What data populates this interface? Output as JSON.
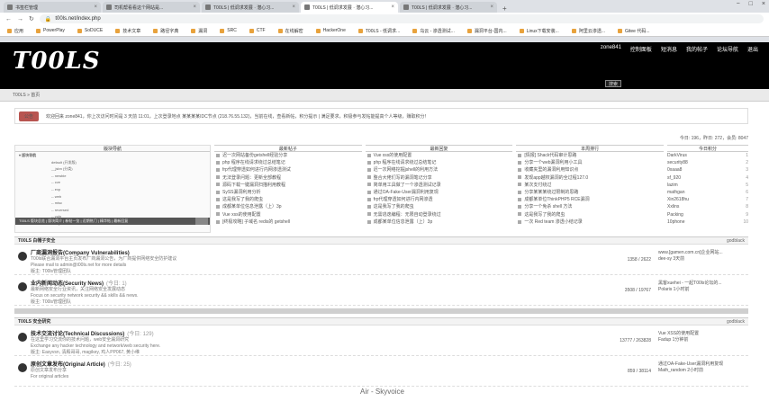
{
  "browser": {
    "tabs": [
      {
        "title": "书签栏管理",
        "active": false
      },
      {
        "title": "司机帮看看这个网站是...",
        "active": false
      },
      {
        "title": "T00LS | 低调求发展 · 潜心习...",
        "active": false
      },
      {
        "title": "T00LS | 低调求发展 · 潜心习...",
        "active": true
      },
      {
        "title": "T00LS | 低调求发展 · 潜心习...",
        "active": false
      }
    ],
    "new_tab": "+",
    "window_controls": [
      "−",
      "□",
      "×"
    ],
    "back": "←",
    "forward": "→",
    "reload": "↻",
    "url": "t00ls.net/index.php",
    "bookmarks": [
      "应用",
      "PowerPlay",
      "SoDUCE",
      "技术文章",
      "路径字典",
      "漏洞",
      "SRC",
      "CTF",
      "在线解密",
      "HackerOne",
      "T00LS - 低调求...",
      "乌云 - 渗透测试...",
      "漏洞平台-国内...",
      "Linux下载安装...",
      "阿里云渗透...",
      "Gitee 代码..."
    ]
  },
  "header": {
    "logo": "T00LS",
    "user_nav": [
      "zone841",
      "控制面板",
      "短消息",
      "我的帖子",
      "论坛导航",
      "退出"
    ],
    "header_button": "搜索"
  },
  "breadcrumb": "T00LS » 首页",
  "notice": {
    "button": "公告",
    "text": "欢迎回来 zone841，你上次访问时间是 3 天前 11:01，上次登录地点 某某某某IDC节点 (218.76.55.132)，当前在线，查看新帖，积分提示 | 满足要求，积极参与发帖能提高个人等级，赚取积分！"
  },
  "stats": "今日: 196，昨日: 272，会员: 8047",
  "columns": {
    "tree": "版块导航",
    "new": "最新帖子",
    "hot": "最新回复",
    "week": "本周排行",
    "rank": "今日积分"
  },
  "tree_items": [
    "▾ 版块导航",
    "default (开发版)",
    "__jsbn (分类)",
    "-- newbie",
    "-- cve",
    "-- exp",
    "-- web",
    "-- misc",
    "-- reversed",
    "-- vuln",
    "-- exploit"
  ],
  "tree_bar": "T00LS 版块总览 | 版块简介 | 新帖一览 | 近期热门 | 精华帖 | 最新回复",
  "new_posts": [
    "迟一次网站备份getshell经验分享",
    "php 程序在线请求绕过总结笔记",
    "frp代理穿透如何进行内网渗透测试",
    "无法登录问题：更新全部教程",
    "源码下载一键漏洞扫描利用教程",
    "SySS漏洞利用分析",
    "这是我写了我的爬虫",
    "成都某单位信息泄露（上）3p",
    "Vue xss的使用配置",
    "[终极攻略] 子域名 redis的 getshell"
  ],
  "replies": [
    "Vue xss的使用配置",
    "php 程序在线请求绕过总结笔记",
    "迟一次网络挖掘jshell的利用方法",
    "整合大佬们写的漏洞笔记分享",
    "简单用工具做了一个渗透测试记录",
    "通过OA-Fake-User漏洞利用复现",
    "frp代理穿透如何进行内网渗透",
    "这是我写了我的爬虫",
    "无需逃逸编程：无限自动登录绕过",
    "成都某单位信息泄露（上）3p"
  ],
  "week": [
    "[情报] Shack代码审计思路",
    "分享一个web漏洞利用小工具",
    "收藏夹里的漏洞利用知识点",
    "发现app越权漏洞的全过程127.0",
    "某次支付绕过",
    "分享某某某绕过限制的思路",
    "成都某单位ThinkPHP5 RCE漏洞",
    "分享一个免杀 shell 方法",
    "这是我写了我的爬虫",
    "一次 Red team 渗透小结记录"
  ],
  "ranks": [
    [
      "DarkVirus",
      "1"
    ],
    [
      "security88",
      "2"
    ],
    [
      "0xaaa8",
      "3"
    ],
    [
      "sf_920",
      "4"
    ],
    [
      "lazim",
      "5"
    ],
    [
      "mathgan",
      "6"
    ],
    [
      "Xin2618hu",
      "7"
    ],
    [
      "Xxlins",
      "8"
    ],
    [
      "Packing",
      "9"
    ],
    [
      "10phone",
      "10"
    ]
  ],
  "sections": [
    {
      "name": "T00LS 白帽子安全",
      "moderator": "godblack",
      "forums": [
        {
          "title": "厂商漏洞报告(Company Vulnerabilities)",
          "desc1": "T00ls联合漏洞平台主页发布厂商漏洞公告，为厂商提供网络安全防护建议",
          "desc2": "Please mail to admin@t00ls.net for more details",
          "desc3": "版主: T00ls管理团队",
          "count": "1358 / 2622",
          "last1": "www.[gamen.com.cn]企业网站...",
          "last2": "dee-sy  3天前"
        },
        {
          "title": "业内新闻动态(Security News)",
          "today": "(今日: 1)",
          "desc1": "最新网络安全行业资讯，关注网络安全发展动态",
          "desc2": "Focus on security network security && skills && news.",
          "desc3": "版主: T00ls管理团队",
          "count": "3508 / 19767",
          "last1": "黑客xuehei - 一起T00ls论坛的...",
          "last2": "Polaris  1小时前"
        }
      ]
    },
    {
      "name": "T00LS 安全研究",
      "moderator": "godblack",
      "forums": [
        {
          "title": "技术交流讨论(Technical Discussions)",
          "today": "(今日: 129)",
          "desc1": "在这里学习交流你的技术问题，web安全漏洞研究",
          "desc2": "Exchange any hacker technology and network/web security here.",
          "desc3": "版主: Easyvsn, 清殿哥哥, magikey, 鸡人PP067, 黄小维",
          "count": "13777 / 263828",
          "last1": "Vue XSS的使用配置",
          "last2": "Fadup  1分钟前"
        },
        {
          "title": "原创文章发布(Original Article)",
          "today": "(今日: 25)",
          "desc1": "原创文章发布分享",
          "desc2": "For original articles",
          "desc3": "",
          "count": "859 / 38114",
          "last1": "通过OA-Fake-User漏洞利用复现",
          "last2": "Math_random  2小时前"
        }
      ]
    }
  ],
  "section1_bar_right": "T00ls管理团队 | 18",
  "watermark": "Air - Skyvoice"
}
